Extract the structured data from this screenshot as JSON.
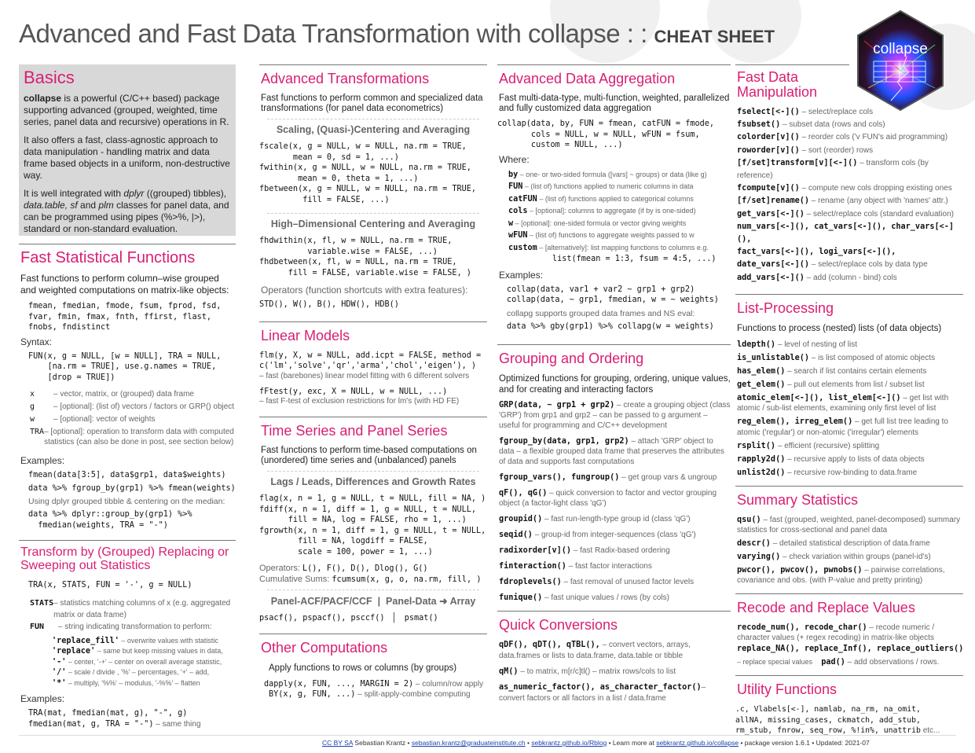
{
  "header": {
    "title": "Advanced and Fast Data Transformation with collapse : :",
    "subtitle": "CHEAT SHEET",
    "logo_text": "collapse",
    "logo_icon": "hex-sticker-icon"
  },
  "basics": {
    "title": "Basics",
    "p1_bold": "collapse",
    "p1_rest": " is a powerful (C/C++ based) package supporting advanced (grouped, weighted, time series, panel data and recursive) operations in R.",
    "p2": "It also offers a fast, class-agnostic approach to data manipulation - handling matrix and data frame based objects in a uniform, non-destructive way.",
    "p3_a": "It is well integrated with ",
    "p3_dplyr": "dplyr",
    "p3_b": " ((grouped) tibbles), ",
    "p3_dt": "data.table, sf",
    "p3_c": " and ",
    "p3_plm": "plm",
    "p3_d": " classes for panel data, and can be programmed using pipes (%>%, |>), standard or non-standard evaluation."
  },
  "fast_stat": {
    "title": "Fast Statistical Functions",
    "intro": "Fast functions to perform column–wise grouped and weighted computations on matrix-like objects:",
    "functions": "fmean, fmedian, fmode, fsum, fprod, fsd,\nfvar, fmin, fmax, fnth, ffirst, flast,\nfnobs, fndistinct",
    "syntax_label": "Syntax:",
    "syntax": "FUN(x, g = NULL, [w = NULL], TRA = NULL,\n    [na.rm = TRUE], use.g.names = TRUE,\n    [drop = TRUE])",
    "args": [
      {
        "k": "x",
        "v": "– vector, matrix, or (grouped) data frame"
      },
      {
        "k": "g",
        "v": "– [optional]: (list of) vectors / factors or GRP() object"
      },
      {
        "k": "w",
        "v": "– [optional]: vector of weights"
      },
      {
        "k": "TRA",
        "v": "– [optional]: operation to transform data with computed statistics (can also be done in post, see section below)"
      }
    ],
    "examples_label": "Examples:",
    "ex1": "fmean(data[3:5], data$grp1, data$weights)",
    "ex2": "data %>% fgroup_by(grp1) %>% fmean(weights)",
    "ex_note": "Using dplyr grouped tibble & centering on the median:",
    "ex3": "data %>% dplyr::group_by(grp1) %>%\n  fmedian(weights, TRA = \"-\")"
  },
  "transform": {
    "title": "Transform by (Grouped) Replacing or Sweeping out Statistics",
    "syntax": "TRA(x, STATS, FUN = '-', g = NULL)",
    "stats_k": "STATS",
    "stats_v": "– statistics matching columns of x (e.g. aggregated matrix or data frame)",
    "fun_k": "FUN",
    "fun_v": "– string indicating transformation to perform:",
    "ops": [
      {
        "code": "'replace_fill'",
        "desc": " – overwrite values with statistic"
      },
      {
        "code": "'replace'",
        "desc": " – same but keep missing values in data,"
      },
      {
        "code": "'-'",
        "desc": " – center, '-+' – center on overall average statistic,"
      },
      {
        "code": "'/'",
        "desc": " – scale / divide , '%' – percentages, '+' – add,"
      },
      {
        "code": "'*'",
        "desc": " – multiply, '%%' – modulus, '-%%' – flatten"
      }
    ],
    "examples_label": "Examples:",
    "ex1": "TRA(mat, fmedian(mat, g), \"-\", g)",
    "ex2": "fmedian(mat, g, TRA = \"-\")",
    "ex2_note": " – same thing"
  },
  "adv_trans": {
    "title": "Advanced Transformations",
    "intro": "Fast functions to perform common and specialized data transformations (for panel data econometrics)",
    "sub1": "Scaling, (Quasi-)Centering and Averaging",
    "code1": "fscale(x, g = NULL, w = NULL, na.rm = TRUE,\n       mean = 0, sd = 1, ...)\nfwithin(x, g = NULL, w = NULL, na.rm = TRUE,\n        mean = 0, theta = 1, ...)\nfbetween(x, g = NULL, w = NULL, na.rm = TRUE,\n         fill = FALSE, ...)",
    "sub2": "High–Dimensional Centering and Averaging",
    "code2": "fhdwithin(x, fl, w = NULL, na.rm = TRUE,\n          variable.wise = FALSE, ...)\nfhdbetween(x, fl, w = NULL, na.rm = TRUE,\n      fill = FALSE, variable.wise = FALSE, )",
    "ops_label": "Operators (function shortcuts with extra features):",
    "ops": "STD(), W(), B(), HDW(), HDB()"
  },
  "linear": {
    "title": "Linear Models",
    "code1": "flm(y, X, w = NULL, add.icpt = FALSE, method =\nc('lm','solve','qr','arma','chol','eigen'), )",
    "desc1": "– fast (barebones) linear model fitting with 6 different solvers",
    "code2": "fFtest(y, exc, X = NULL, w = NULL, ...)",
    "desc2": "– fast F-test of exclusion restrictions for lm's (with HD FE)"
  },
  "timeseries": {
    "title": "Time Series and Panel Series",
    "intro": "Fast functions to perform time-based computations on (unordered) time series and (unbalanced) panels",
    "sub1": "Lags / Leads, Differences and Growth Rates",
    "code1": "flag(x, n = 1, g = NULL, t = NULL, fill = NA, )\nfdiff(x, n = 1, diff = 1, g = NULL, t = NULL,\n      fill = NA, log = FALSE, rho = 1, ...)\nfgrowth(x, n = 1, diff = 1, g = NULL, t = NULL,\n        fill = NA, logdiff = FALSE,\n        scale = 100, power = 1, ...)",
    "ops_label": "Operators: ",
    "ops": "L(), F(), D(), Dlog(), G()",
    "cum_label": "Cumulative Sums: ",
    "cum": "fcumsum(x, g, o, na.rm, fill, )",
    "sub2a": "Panel-ACF/PACF/CCF",
    "sub2b": "Panel-Data",
    "sub2c": "Array",
    "code2a": "psacf(), pspacf(), psccf()",
    "code2b": "psmat()"
  },
  "other": {
    "title": "Other Computations",
    "intro": "Apply functions to rows or columns (by groups)",
    "r1_code": "dapply(x, FUN, ..., MARGIN = 2)",
    "r1_desc": " – column/row apply",
    "r2_code": "BY(x, g, FUN, ...)",
    "r2_desc": " – split-apply-combine computing"
  },
  "aggregation": {
    "title": "Advanced Data Aggregation",
    "intro": "Fast multi-data-type, multi-function, weighted, parallelized and fully customized data aggregation",
    "code": "collap(data, by, FUN = fmean, catFUN = fmode,\n       cols = NULL, w = NULL, wFUN = fsum,\n       custom = NULL, ...)",
    "where_label": "Where:",
    "args": [
      {
        "k": "by",
        "v": " – one- or two-sided formula ([vars] ~ groups) or data (like g)"
      },
      {
        "k": "FUN",
        "v": " – (list of) functions applied to numeric columns in data"
      },
      {
        "k": "catFUN",
        "v": " – (list of) functions applied to categorical columns"
      },
      {
        "k": "cols",
        "v": " – [optional]: columns to aggregate (if by is one-sided)"
      },
      {
        "k": "w",
        "v": " – [optional]: one-sided formula or vector giving weights"
      },
      {
        "k": "wFUN",
        "v": " – (list of) functions to aggregate weights passed to w"
      },
      {
        "k": "custom",
        "v": " – [alternatively]: list mapping functions to columns e.g."
      }
    ],
    "custom_ex": "list(fmean = 1:3, fsum = 4:5, ...)",
    "examples_label": "Examples:",
    "ex1": "collap(data, var1 + var2 ~ grp1 + grp2)\ncollap(data, ~ grp1, fmedian, w = ~ weights)",
    "ex_note": "collapg supports grouped data frames and NS eval:",
    "ex2": "data %>% gby(grp1) %>% collapg(w = weights)"
  },
  "grouping": {
    "title": "Grouping and Ordering",
    "intro": "Optimized functions for grouping, ordering, unique values, and for creating and interacting factors",
    "items": [
      {
        "code": "GRP(data, ~ grp1 + grp2)",
        "desc": " – create a grouping object (class 'GRP') from grp1 and grp2 – can be passed to g argument – useful for programming and C/C++ development"
      },
      {
        "code": "fgroup_by(data, grp1, grp2)",
        "desc": " – attach 'GRP' object to data – a flexible grouped data frame that preserves the attributes of data and supports fast computations"
      },
      {
        "code": "fgroup_vars(), fungroup()",
        "desc": " – get group vars & ungroup"
      },
      {
        "code": "qF(), qG()",
        "desc": " – quick conversion to factor and vector grouping object (a factor-light class 'qG')"
      },
      {
        "code": "groupid()",
        "desc": " – fast run-length-type group id (class 'qG')"
      },
      {
        "code": "seqid()",
        "desc": " – group-id from integer-sequences (class 'qG')"
      },
      {
        "code": "radixorder[v]()",
        "desc": " – fast Radix-based ordering"
      },
      {
        "code": "finteraction()",
        "desc": " – fast factor interactions"
      },
      {
        "code": "fdroplevels()",
        "desc": " – fast removal of unused factor levels"
      },
      {
        "code": "funique()",
        "desc": " – fast unique values / rows (by cols)"
      }
    ]
  },
  "conversions": {
    "title": "Quick Conversions",
    "items": [
      {
        "code": "qDF(), qDT(), qTBL(),",
        "desc": " – convert vectors, arrays, data.frames or lists to data.frame, data.table or tibble"
      },
      {
        "code": "qM()",
        "desc": " – to matrix, m[r/c]tl() – matrix rows/cols to list"
      },
      {
        "code": "as_numeric_factor(), as_character_factor()",
        "desc": "– convert factors or all factors in a list / data.frame"
      }
    ]
  },
  "manip": {
    "title": "Fast Data Manipulation",
    "items": [
      {
        "code": "fselect[<-]()",
        "desc": " – select/replace cols"
      },
      {
        "code": "fsubset()",
        "desc": " – subset data (rows and cols)"
      },
      {
        "code": "colorder[v]()",
        "desc": " – reorder cols ('v FUN's aid programming)"
      },
      {
        "code": "roworder[v]()",
        "desc": " – sort (reorder) rows"
      },
      {
        "code": "[f/set]transform[v][<-]()",
        "desc": " – transform cols (by reference)"
      },
      {
        "code": "fcompute[v]()",
        "desc": " – compute new cols dropping existing ones"
      },
      {
        "code": "[f/set]rename()",
        "desc": " – rename (any object with 'names' attr.)"
      },
      {
        "code": "get_vars[<-]()",
        "desc": " – select/replace cols (standard evaluation)"
      },
      {
        "code": "num_vars[<-](), cat_vars[<-](), char_vars[<-](),",
        "desc": ""
      },
      {
        "code": "fact_vars[<-](), logi_vars[<-](),",
        "desc": ""
      },
      {
        "code": "date_vars[<-]()",
        "desc": " – select/replace cols by data type"
      },
      {
        "code": "add_vars[<-]()",
        "desc": " – add (column - bind) cols"
      }
    ]
  },
  "lists": {
    "title": "List-Processing",
    "intro": "Functions to process (nested) lists (of data objects)",
    "items": [
      {
        "code": "ldepth()",
        "desc": " – level of nesting of list"
      },
      {
        "code": "is_unlistable()",
        "desc": " – is list composed of atomic objects"
      },
      {
        "code": "has_elem()",
        "desc": " – search if list contains certain elements"
      },
      {
        "code": "get_elem()",
        "desc": " – pull out elements from list / subset list"
      },
      {
        "code": "atomic_elem[<-](), list_elem[<-]()",
        "desc": " – get list with atomic / sub-list elements, examining only first level of list"
      },
      {
        "code": "reg_elem(), irreg_elem()",
        "desc": " – get full list tree leading to atomic ('regular') or non-atomic ('irregular') elements"
      },
      {
        "code": "rsplit()",
        "desc": " – efficient (recursive) splitting"
      },
      {
        "code": "rapply2d()",
        "desc": " – recursive apply to lists of data objects"
      },
      {
        "code": "unlist2d()",
        "desc": " – recursive row-binding to data.frame"
      }
    ]
  },
  "summary": {
    "title": "Summary Statistics",
    "items": [
      {
        "code": "qsu()",
        "desc": " – fast (grouped, weighted, panel-decomposed) summary statistics for cross-sectional and panel data"
      },
      {
        "code": "descr()",
        "desc": " – detailed statistical description of data.frame"
      },
      {
        "code": "varying()",
        "desc": " – check variation within groups (panel-id's)"
      },
      {
        "code": "pwcor(), pwcov(), pwnobs()",
        "desc": " – pairwise correlations, covariance and obs. (with P-value and pretty printing)"
      }
    ]
  },
  "recode": {
    "title": "Recode and Replace Values",
    "r1_code": "recode_num(), recode_char()",
    "r1_desc": " – recode numeric / character values (+ regex recoding) in matrix-like objects",
    "r2_code": "replace_NA(), replace_Inf(), replace_outliers()",
    "r3_desc": "– replace special values",
    "r3_code": "pad()",
    "r3_desc2": " – add observations / rows."
  },
  "utility": {
    "title": "Utility Functions",
    "code": ".c, Vlabels[<-], namlab, na_rm, na_omit,\nallNA, missing_cases, ckmatch, add_stub,\nrm_stub, fnrow, seq_row, %!in%, unattrib",
    "etc": " etc..."
  },
  "footer": {
    "license": "CC BY SA",
    "author": " Sebastian Krantz  •  ",
    "email": "sebastian.krantz@graduateinstitute.ch",
    "sep1": "  •  ",
    "blog": "sebkrantz.github.io/Rblog",
    "learn": "  •  Learn more at ",
    "site": "sebkrantz.github.io/collapse",
    "version": "  •  package version  1.6.1  •  Updated: 2021-07"
  }
}
